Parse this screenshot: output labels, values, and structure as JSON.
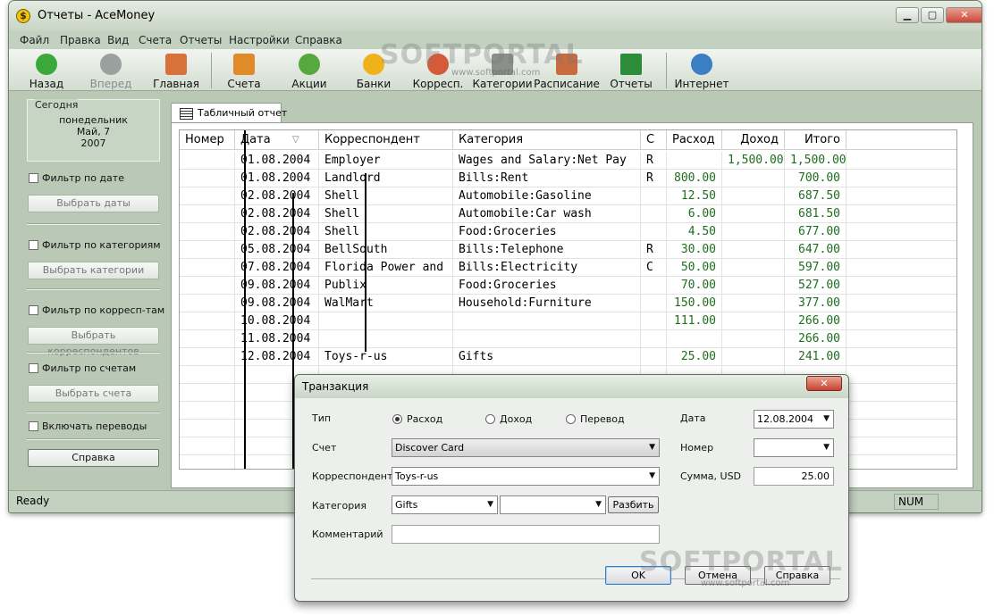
{
  "window": {
    "title": "Отчеты - AceMoney",
    "controls": [
      "0",
      "1",
      "r"
    ]
  },
  "menu": [
    "Файл",
    "Правка",
    "Вид",
    "Счета",
    "Отчеты",
    "Настройки",
    "Справка"
  ],
  "toolbar": [
    {
      "label": "Назад",
      "icon": "back-arrow-icon",
      "color": "#3aa83a",
      "disabled": false
    },
    {
      "label": "Вперед",
      "icon": "forward-arrow-icon",
      "color": "#9aa0a0",
      "disabled": true
    },
    {
      "label": "Главная",
      "icon": "home-icon",
      "color": "#d9713b",
      "disabled": false
    },
    {
      "label": "Счета",
      "icon": "accounts-icon",
      "color": "#e08a2a",
      "disabled": false
    },
    {
      "label": "Акции",
      "icon": "stocks-icon",
      "color": "#56a93c",
      "disabled": false
    },
    {
      "label": "Банки",
      "icon": "bank-coin-icon",
      "color": "#f0b21b",
      "disabled": false
    },
    {
      "label": "Корресп.",
      "icon": "payees-icon",
      "color": "#d35b3c",
      "disabled": false
    },
    {
      "label": "Категории",
      "icon": "categories-icon",
      "color": "#8a8f8a",
      "disabled": false
    },
    {
      "label": "Расписание",
      "icon": "schedule-icon",
      "color": "#c86b3e",
      "disabled": false
    },
    {
      "label": "Отчеты",
      "icon": "reports-chart-icon",
      "color": "#2d8c3a",
      "disabled": false
    },
    {
      "label": "Интернет",
      "icon": "internet-globe-icon",
      "color": "#3a7ec4",
      "disabled": false
    }
  ],
  "left_panel": {
    "today_label": "Сегодня",
    "today_lines": [
      "понедельник",
      "Май, 7",
      "2007"
    ],
    "filter_date": {
      "label": "Фильтр по дате",
      "button": "Выбрать даты"
    },
    "filter_categories": {
      "label": "Фильтр по категориям",
      "button": "Выбрать категории"
    },
    "filter_payees": {
      "label": "Фильтр по корресп-там",
      "button": "Выбрать корреспондентов"
    },
    "filter_accounts": {
      "label": "Фильтр по счетам",
      "button": "Выбрать счета"
    },
    "include_transfers": {
      "label": "Включать переводы"
    },
    "help_button": "Справка"
  },
  "report": {
    "tab_label": "Табличный отчет",
    "columns": [
      "Номер",
      "Дата",
      "Корреспондент",
      "Категория",
      "С",
      "Расход",
      "Доход",
      "Итого"
    ],
    "sort_indicator": "▽",
    "rows": [
      {
        "num": "",
        "date": "01.08.2004",
        "payee": "Employer",
        "category": "Wages and Salary:Net Pay",
        "c": "R",
        "expense": "",
        "income": "1,500.00",
        "total": "1,500.00"
      },
      {
        "num": "",
        "date": "01.08.2004",
        "payee": "Landlord",
        "category": "Bills:Rent",
        "c": "R",
        "expense": "800.00",
        "income": "",
        "total": "700.00"
      },
      {
        "num": "",
        "date": "02.08.2004",
        "payee": "Shell",
        "category": "Automobile:Gasoline",
        "c": "",
        "expense": "12.50",
        "income": "",
        "total": "687.50"
      },
      {
        "num": "",
        "date": "02.08.2004",
        "payee": "Shell",
        "category": "Automobile:Car wash",
        "c": "",
        "expense": "6.00",
        "income": "",
        "total": "681.50"
      },
      {
        "num": "",
        "date": "02.08.2004",
        "payee": "Shell",
        "category": "Food:Groceries",
        "c": "",
        "expense": "4.50",
        "income": "",
        "total": "677.00"
      },
      {
        "num": "",
        "date": "05.08.2004",
        "payee": "BellSouth",
        "category": "Bills:Telephone",
        "c": "R",
        "expense": "30.00",
        "income": "",
        "total": "647.00"
      },
      {
        "num": "",
        "date": "07.08.2004",
        "payee": "Florida Power and ...",
        "category": "Bills:Electricity",
        "c": "C",
        "expense": "50.00",
        "income": "",
        "total": "597.00"
      },
      {
        "num": "",
        "date": "09.08.2004",
        "payee": "Publix",
        "category": "Food:Groceries",
        "c": "",
        "expense": "70.00",
        "income": "",
        "total": "527.00"
      },
      {
        "num": "",
        "date": "09.08.2004",
        "payee": "WalMart",
        "category": "Household:Furniture",
        "c": "",
        "expense": "150.00",
        "income": "",
        "total": "377.00"
      },
      {
        "num": "",
        "date": "10.08.2004",
        "payee": "",
        "category": "",
        "c": "",
        "expense": "111.00",
        "income": "",
        "total": "266.00"
      },
      {
        "num": "",
        "date": "11.08.2004",
        "payee": "",
        "category": "",
        "c": "",
        "expense": "",
        "income": "",
        "total": "266.00"
      },
      {
        "num": "",
        "date": "12.08.2004",
        "payee": "Toys-r-us",
        "category": "Gifts",
        "c": "",
        "expense": "25.00",
        "income": "",
        "total": "241.00"
      }
    ]
  },
  "status": {
    "text": "Ready",
    "num": "NUM"
  },
  "dialog": {
    "title": "Транзакция",
    "close": "x",
    "type_label": "Тип",
    "type_options": [
      {
        "label": "Расход",
        "selected": true
      },
      {
        "label": "Доход",
        "selected": false
      },
      {
        "label": "Перевод",
        "selected": false
      }
    ],
    "account_label": "Счет",
    "account_value": "Discover Card",
    "payee_label": "Корреспондент",
    "payee_value": "Toys-r-us",
    "category_label": "Категория",
    "category_value": "Gifts",
    "subcategory_value": "",
    "split_button": "Разбить",
    "comment_label": "Комментарий",
    "comment_value": "",
    "date_label": "Дата",
    "date_value": "12.08.2004",
    "number_label": "Номер",
    "number_value": "",
    "amount_label": "Сумма, USD",
    "amount_value": "25.00",
    "ok_button": "OK",
    "cancel_button": "Отмена",
    "help_button": "Справка"
  },
  "watermark": {
    "text": "SOFTPORTAL",
    "sub": "www.softportal.com"
  }
}
